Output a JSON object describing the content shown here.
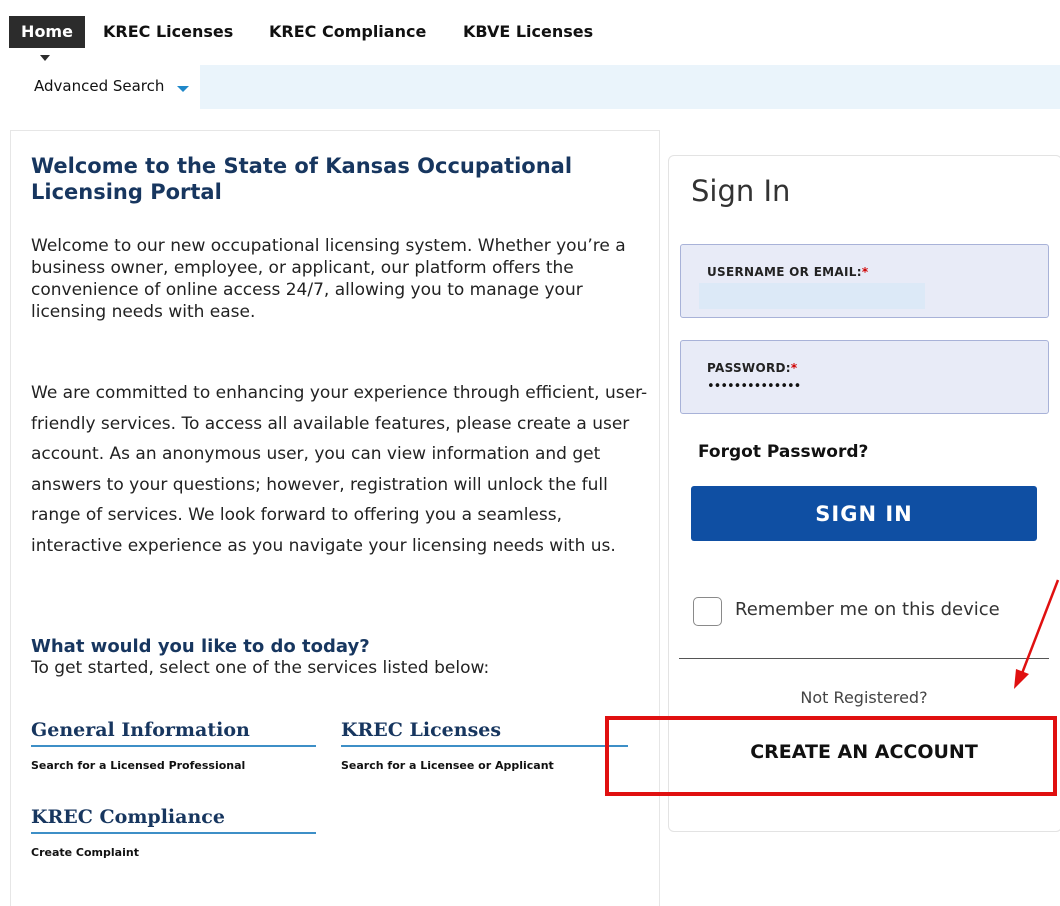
{
  "topnav": {
    "items": [
      "Home",
      "KREC Licenses",
      "KREC Compliance",
      "KBVE Licenses"
    ]
  },
  "subnav": {
    "advanced_search": "Advanced Search"
  },
  "welcome": {
    "title": "Welcome to the State of Kansas Occupational Licensing Portal",
    "intro": "Welcome to our new occupational licensing system. Whether you’re a business owner, employee, or applicant, our platform offers the convenience of online access 24/7, allowing you to manage your licensing needs with ease.",
    "commitment": "We are committed to enhancing your experience through efficient, user-friendly services. To access all available features, please create a user account. As an anonymous user, you can view information and get answers to your questions; however, registration will unlock the full range of services. We look forward to offering you a seamless, interactive experience as you navigate your licensing needs with us.",
    "question_title": "What would you like to do today?",
    "question_sub": "To get started, select one of the services listed below:"
  },
  "services": [
    {
      "title": "General Information",
      "desc": "Search for a Licensed Professional"
    },
    {
      "title": "KREC Licenses",
      "desc": "Search for a Licensee or Applicant"
    },
    {
      "title": "KREC Compliance",
      "desc": "Create Complaint"
    }
  ],
  "signin": {
    "title": "Sign In",
    "username_label": "USERNAME OR EMAIL:",
    "username_value": "",
    "password_label": "PASSWORD:",
    "password_value": "••••••••••••••",
    "required_mark": "*",
    "forgot": "Forgot Password?",
    "button": "SIGN IN",
    "remember": "Remember me on this device",
    "not_registered": "Not Registered?",
    "create_account": "CREATE AN ACCOUNT"
  },
  "colors": {
    "brand_navy": "#17365f",
    "button_blue": "#0f4fa3",
    "field_bg": "#e8ebf7",
    "annotation_red": "#e01010"
  }
}
